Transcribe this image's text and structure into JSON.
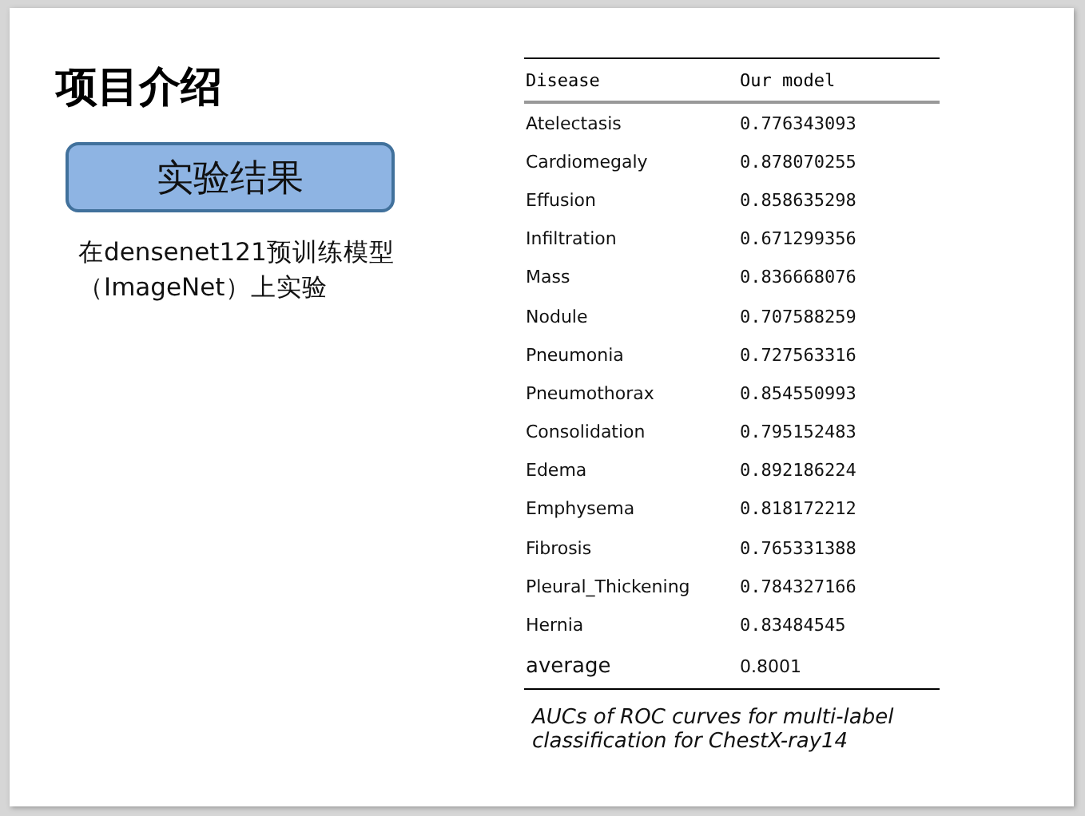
{
  "slide": {
    "title": "项目介绍",
    "label_box": "实验结果",
    "description": "在densenet121预训练模型（ImageNet）上实验",
    "table": {
      "columns": [
        "Disease",
        "Our model"
      ],
      "rows": [
        {
          "kind": "item",
          "disease": "Atelectasis",
          "auc": "0.776343093"
        },
        {
          "kind": "item",
          "disease": "Cardiomegaly",
          "auc": "0.878070255"
        },
        {
          "kind": "item",
          "disease": "Effusion",
          "auc": "0.858635298"
        },
        {
          "kind": "item",
          "disease": "Infiltration",
          "auc": "0.671299356"
        },
        {
          "kind": "item",
          "disease": "Mass",
          "auc": "0.836668076"
        },
        {
          "kind": "item",
          "disease": "Nodule",
          "auc": "0.707588259"
        },
        {
          "kind": "item",
          "disease": "Pneumonia",
          "auc": "0.727563316"
        },
        {
          "kind": "item",
          "disease": "Pneumothorax",
          "auc": "0.854550993"
        },
        {
          "kind": "item",
          "disease": "Consolidation",
          "auc": "0.795152483"
        },
        {
          "kind": "item",
          "disease": "Edema",
          "auc": "0.892186224"
        },
        {
          "kind": "item",
          "disease": "Emphysema",
          "auc": "0.818172212"
        },
        {
          "kind": "item",
          "disease": "Fibrosis",
          "auc": "0.765331388"
        },
        {
          "kind": "item",
          "disease": "Pleural_Thickening",
          "auc": "0.784327166"
        },
        {
          "kind": "item",
          "disease": "Hernia",
          "auc": "0.83484545"
        },
        {
          "kind": "summary",
          "disease": "average",
          "auc": "0.8001"
        }
      ],
      "caption": "AUCs of ROC curves for multi-label classification for ChestX-ray14"
    }
  }
}
